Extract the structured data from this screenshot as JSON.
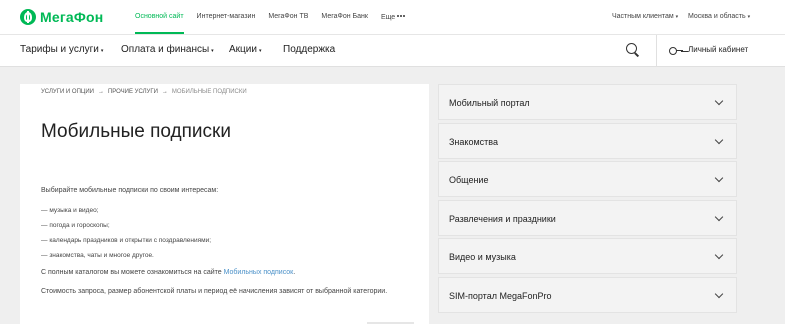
{
  "header": {
    "logo_text": "МегаФон",
    "top_links": [
      {
        "label": "Основной сайт",
        "active": true
      },
      {
        "label": "Интернет-магазин",
        "active": false
      },
      {
        "label": "МегаФон ТВ",
        "active": false
      },
      {
        "label": "МегаФон Банк",
        "active": false
      },
      {
        "label": "Еще",
        "active": false
      }
    ],
    "client_type": "Частным клиентам",
    "region": "Москва и область",
    "brand_color": "#00b956"
  },
  "nav": {
    "items": [
      "Тарифы и услуги",
      "Оплата и финансы",
      "Акции",
      "Поддержка"
    ],
    "cabinet_label": "Личный кабинет",
    "search_icon": "search-icon",
    "cabinet_icon": "key-icon"
  },
  "breadcrumb": {
    "items": [
      "Услуги и опции",
      "Прочие услуги",
      "Мобильные подписки"
    ],
    "separator": "→"
  },
  "main": {
    "title": "Мобильные подписки",
    "intro": "Выбирайте мобильные подписки по своим интересам:",
    "bullets": [
      "музыка и видео;",
      "погода и гороскопы;",
      "календарь праздников и открытки с поздравлениями;",
      "знакомства, чаты и многое другое."
    ],
    "catalog_prefix": "С полным каталогом вы можете ознакомиться на сайте ",
    "catalog_link": "Мобильных подписок",
    "catalog_suffix": ".",
    "cost_note": "Стоимость запроса, размер абонентской платы и период её начисления зависят от выбранной категории.",
    "link_color": "#4a90c8"
  },
  "accordion": {
    "items": [
      "Мобильный портал",
      "Знакомства",
      "Общение",
      "Развлечения и праздники",
      "Видео и музыка",
      "SIM-портал MegaFonPro"
    ]
  }
}
